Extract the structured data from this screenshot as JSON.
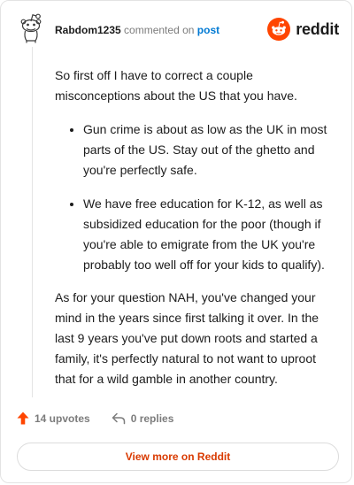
{
  "header": {
    "username": "Rabdom1235",
    "action": "commented on",
    "post_link": "post",
    "brand": "reddit"
  },
  "comment": {
    "intro": "So first off I have to correct a couple misconceptions about the US that you have.",
    "bullets": [
      "Gun crime is about as low as the UK in most parts of the US. Stay out of the ghetto and you're perfectly safe.",
      "We have free education for K-12, as well as subsidized education for the poor (though if you're able to emigrate from the UK you're probably too well off for your kids to qualify)."
    ],
    "closing": "As for your question NAH, you've changed your mind in the years since first talking it over. In the last 9 years you've put down roots and started a family, it's perfectly natural to not want to uproot that for a wild gamble in another country."
  },
  "footer": {
    "upvotes": "14 upvotes",
    "replies": "0 replies",
    "view_more": "View more on Reddit"
  },
  "colors": {
    "brand_orange": "#ff4500",
    "upvote": "#ff4500",
    "link_blue": "#0079d3",
    "view_more_text": "#d93a00"
  },
  "icons": {
    "avatar": "snoo-avatar-icon",
    "brand": "reddit-logo-icon",
    "upvote": "upvote-arrow-icon",
    "reply": "reply-arrow-icon"
  }
}
